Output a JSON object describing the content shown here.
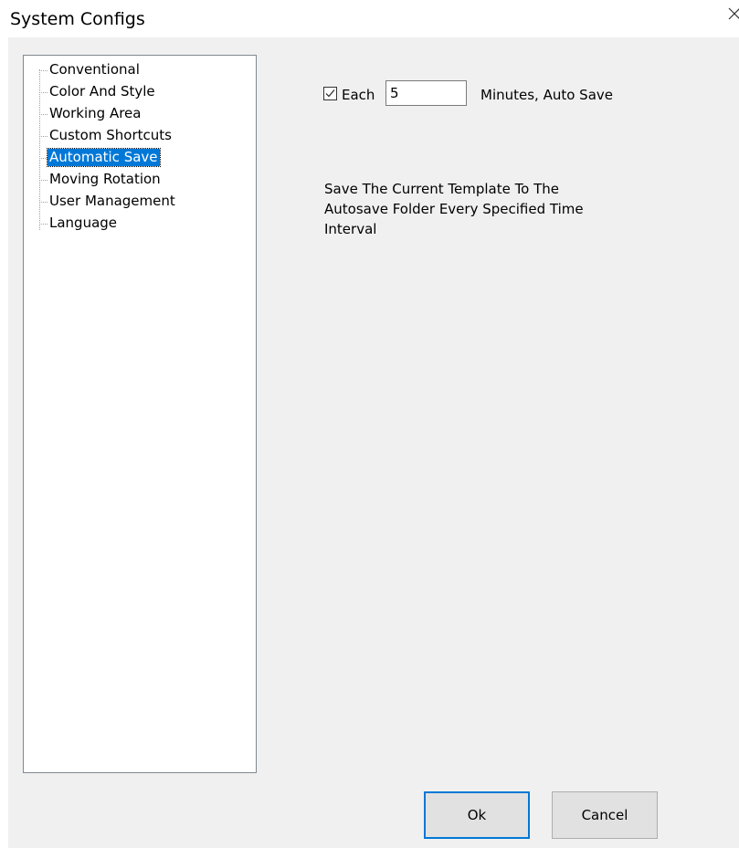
{
  "window": {
    "title": "System Configs"
  },
  "tree": {
    "items": [
      {
        "label": "Conventional",
        "selected": false
      },
      {
        "label": "Color And Style",
        "selected": false
      },
      {
        "label": "Working Area",
        "selected": false
      },
      {
        "label": "Custom Shortcuts",
        "selected": false
      },
      {
        "label": "Automatic Save",
        "selected": true
      },
      {
        "label": "Moving Rotation",
        "selected": false
      },
      {
        "label": "User Management",
        "selected": false
      },
      {
        "label": "Language",
        "selected": false
      }
    ]
  },
  "autosave": {
    "checked": true,
    "each_label": "Each",
    "minutes_value": "5",
    "minutes_label": "Minutes, Auto Save",
    "description_lines": [
      "Save The Current Template To The",
      "Autosave Folder Every Specified Time",
      "Interval"
    ]
  },
  "buttons": {
    "ok_label": "Ok",
    "cancel_label": "Cancel"
  },
  "colors": {
    "selection": "#0078d7",
    "dialog_background": "#f0f0f0",
    "default_button_border": "#0078d7"
  },
  "icons": {
    "close": "close-icon",
    "checkmark": "checkmark-icon"
  }
}
